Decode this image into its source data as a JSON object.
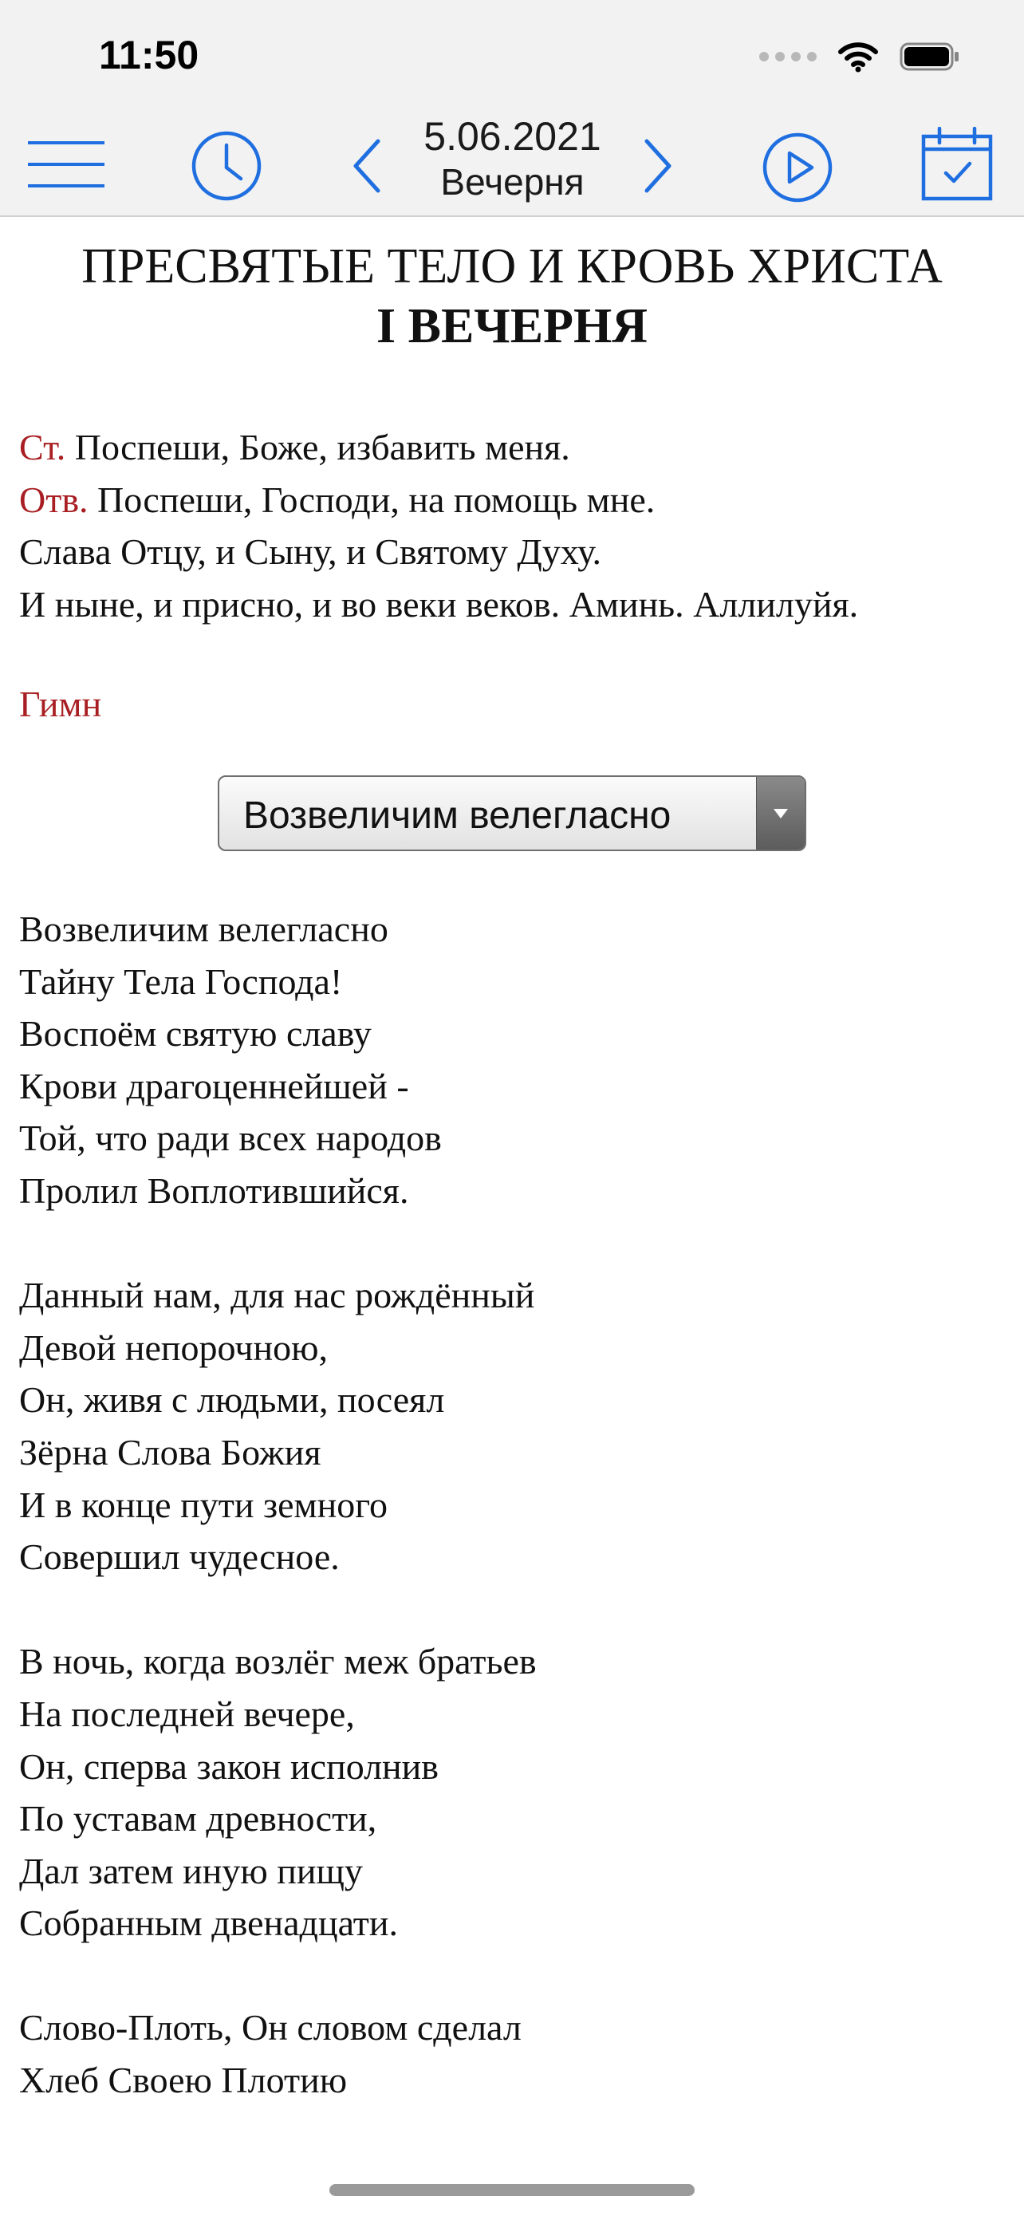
{
  "status_bar": {
    "time": "11:50",
    "icons": [
      "signal-dots-icon",
      "wifi-icon",
      "battery-icon"
    ]
  },
  "toolbar": {
    "icons": [
      "menu-icon",
      "clock-icon",
      "chevron-left-icon",
      "chevron-right-icon",
      "play-icon",
      "calendar-check-icon"
    ],
    "date": "5.06.2021",
    "office": "Вечерня",
    "accent_color": "#1f6fe0"
  },
  "content": {
    "feast_title": "ПРЕСВЯТЫЕ ТЕЛО И КРОВЬ ХРИСТА",
    "office_title": "I ВЕЧЕРНЯ",
    "intro": [
      {
        "label": "Ст.",
        "text": " Поспеши, Боже, избавить меня."
      },
      {
        "label": "Отв.",
        "text": " Поспеши, Господи, на помощь мне."
      },
      {
        "label": "",
        "text": "Слава Отцу, и Сыну, и Святому Духу."
      },
      {
        "label": "",
        "text": "И ныне, и присно, и во веки веков. Аминь. Аллилуйя."
      }
    ],
    "hymn_label": "Гимн",
    "hymn_select": "Возвеличим велегласно",
    "rubric_color": "#a81e22",
    "stanzas": [
      [
        "Возвеличим велегласно",
        "Тайну Тела Господа!",
        "Воспоём святую славу",
        "Крови драгоценнейшей -",
        "Той, что ради всех народов",
        "Пролил Воплотившийся."
      ],
      [
        "Данный нам, для нас рождённый",
        "Девой непорочною,",
        "Он, живя с людьми, посеял",
        "Зёрна Слова Божия",
        "И в конце пути земного",
        "Совершил чудесное."
      ],
      [
        "В ночь, когда возлёг меж братьев",
        "На последней вечере,",
        "Он, сперва закон исполнив",
        "По уставам древности,",
        "Дал затем иную пищу",
        "Собранным двенадцати."
      ],
      [
        "Слово-Плоть, Он словом сделал",
        "Хлеб Своею Плотию"
      ]
    ]
  }
}
